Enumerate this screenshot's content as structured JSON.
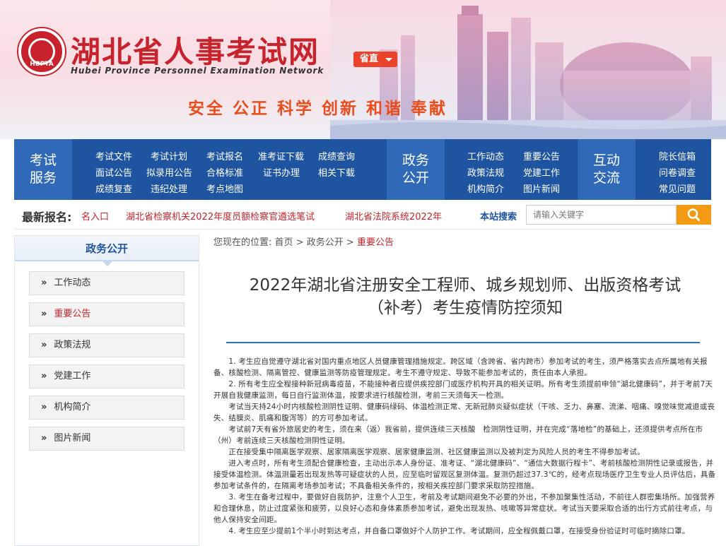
{
  "header": {
    "logo_text": "HBPTA",
    "site_title": "湖北省人事考试网",
    "site_subtitle": "Hubei Province Personnel Examination Network",
    "region_button": "省直",
    "slogan": "安全 公正 科学 创新 和谐 奉献"
  },
  "nav": {
    "groups": [
      {
        "head": [
          "考试",
          "服务"
        ],
        "links": [
          "考试文件",
          "考试计划",
          "考试报名",
          "准考证下载",
          "成绩查询",
          "面试公告",
          "拟录用公告",
          "合格标准",
          "证书办理",
          "相关下载",
          "成绩复查",
          "违纪处理",
          "考点地图"
        ]
      },
      {
        "head": [
          "政务",
          "公开"
        ],
        "links": [
          "工作动态",
          "重要公告",
          "政策法规",
          "党建工作",
          "机构简介",
          "图片新闻"
        ]
      },
      {
        "head": [
          "互动",
          "交流"
        ],
        "links": [
          "院长信箱",
          "问卷调查",
          "常见问题"
        ]
      }
    ]
  },
  "ticker": {
    "label": "最新报名:",
    "items": [
      "名入口",
      "湖北省检察机关2022年度员额检察官遴选笔试",
      "湖北省法院系统2022年"
    ]
  },
  "search": {
    "label": "本站搜索",
    "placeholder": "请输入关键字"
  },
  "sidebar": {
    "title": "政务公开",
    "items": [
      "工作动态",
      "重要公告",
      "政策法规",
      "党建工作",
      "机构简介",
      "图片新闻"
    ],
    "active_index": 1
  },
  "breadcrumb": {
    "prefix": "您现在的位置:",
    "home": "首页",
    "section": "政务公开",
    "current": "重要公告",
    "sep": ">"
  },
  "article": {
    "title_line1": "2022年湖北省注册安全工程师、城乡规划师、出版资格考试",
    "title_line2": "（补考）考生疫情防控须知",
    "paragraphs": [
      "　　1. 考生应自觉遵守湖北省对国内重点地区人员健康管理措施规定。跨区域（含跨省、省内跨市）参加考试的考生，须严格落实去点所属地有关报备、核酸检测、隔离管控、健康监测等防疫管理规定。考生不遵守规定、导致不能参加考试的，责任由本人承担。",
      "　　2. 所有考生应全程接种新冠病毒疫苗，不能接种者应提供疾控部门或医疗机构开具的相关证明。所有考生须提前申领“湖北健康码”，并于考前7天开展自我健康监测，每日自行监测体温，按要求进行核酸检测，考前三天须每天一检测。",
      "　　考试当天持24小时内核酸检测阴性证明、健康码绿码、体温检测正常、无新冠肺炎疑似症状（干咳、乏力、鼻塞、流涕、咽痛、嗅觉味觉减退或丧失、结膜炎、肌痛和腹泻等）的方可参加考试。",
      "　　考试前7天有省外旅居史的考生，须在来（返）我省前，提供连续三天核酸　检测阴性证明，并在完成“落地检”的基础上，还须提供考点所在市（州）考前连续三天核酸检测阴性证明。",
      "　　正在接受集中隔离医学观察、居家隔离医学观察、居家健康监测、社区健康监测以及被判定为风险人员的考生不得参加考试。",
      "　　进入考点时，所有考生须配合健康检查，主动出示本人身份证、准考证、“湖北健康码”、“通信大数据行程卡”、考前核酸检测阴性记录或报告，并接受体温检测。体温测量若出现发热等可疑症状的人员，应至临时留观区复测体温。复测仍超过37.3℃的，经考点现场医疗卫生专业人员评估后，具备参加考试条件的，在隔离考场参加考试；不具备相关条件的，按相关疾控部门要求采取防控措施。",
      "　　3. 考生在备考过程中，要做好自我防护，注意个人卫生，考前及考试期间避免不必要的外出，不参加聚集性活动，不前往人群密集场所。加强营养和合理休息，防止过度紧张和疲劳，以良好心态和身体素质参加考试，避免出现发热、咳嗽等异常症状。考试当天要采取合适的出行方式前往考点，与他人保持安全间距。",
      "　　4. 考生应至少提前1个半小时到达考点，并自备口罩做好个人防护工作。考试期间，应全程佩戴口罩，在接受身份验证时可临时摘除口罩。"
    ]
  },
  "colors": {
    "brand_red": "#c8232c",
    "nav_blue": "#1f54a0",
    "search_orange": "#f39a12"
  }
}
